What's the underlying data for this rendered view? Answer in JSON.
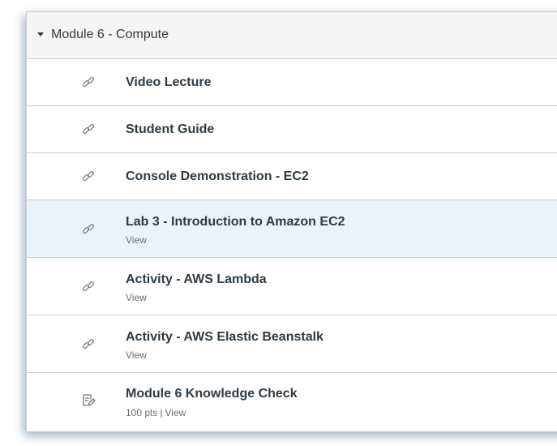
{
  "module": {
    "title": "Module 6 - Compute",
    "caret_icon": "caret-down-icon"
  },
  "items": [
    {
      "title": "Video Lecture",
      "icon": "link-icon"
    },
    {
      "title": "Student Guide",
      "icon": "link-icon"
    },
    {
      "title": "Console Demonstration - EC2",
      "icon": "link-icon"
    },
    {
      "title": "Lab 3 - Introduction to Amazon EC2",
      "sub": "View",
      "icon": "link-icon"
    },
    {
      "title": "Activity - AWS Lambda",
      "sub": "View",
      "icon": "link-icon"
    },
    {
      "title": "Activity - AWS Elastic Beanstalk",
      "sub": "View",
      "icon": "link-icon"
    },
    {
      "title": "Module 6 Knowledge Check",
      "points": "100 pts",
      "sub": "View",
      "icon": "quiz-icon"
    }
  ],
  "colors": {
    "text": "#2d3b45",
    "subtext": "#66717a",
    "border": "#c7cdd1",
    "highlight": "#eaf3fa",
    "header_bg": "#f5f5f5"
  }
}
